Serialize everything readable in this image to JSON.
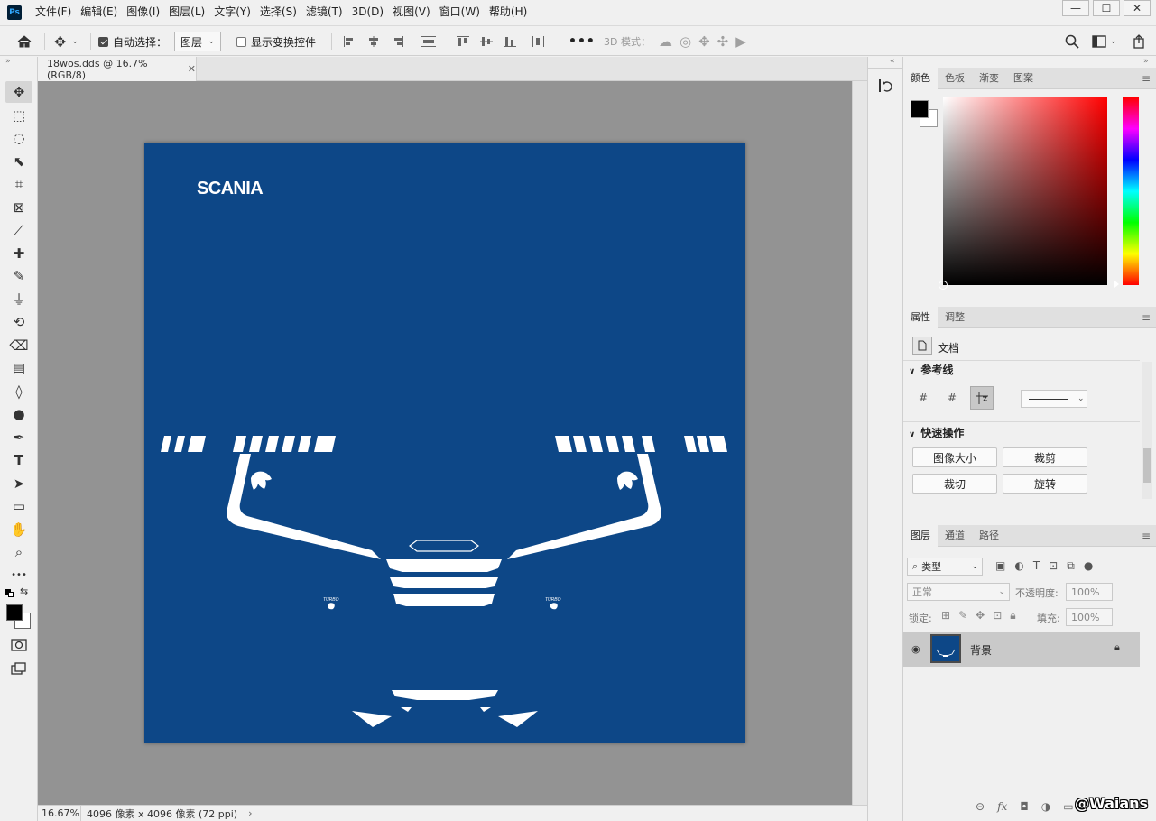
{
  "app": {
    "logo": "Ps"
  },
  "menu": [
    "文件(F)",
    "编辑(E)",
    "图像(I)",
    "图层(L)",
    "文字(Y)",
    "选择(S)",
    "滤镜(T)",
    "3D(D)",
    "视图(V)",
    "窗口(W)",
    "帮助(H)"
  ],
  "window_controls": {
    "minimize": "—",
    "maximize": "☐",
    "close": "✕"
  },
  "options": {
    "auto_select_label": "自动选择：",
    "auto_select_checked": true,
    "auto_select_target": "图层",
    "transform_label": "显示变换控件",
    "transform_checked": false,
    "mode_3d_label": "3D 模式："
  },
  "tools": [
    {
      "name": "move-tool",
      "glyph": "✥",
      "active": true
    },
    {
      "name": "marquee-tool",
      "glyph": "⬚"
    },
    {
      "name": "lasso-tool",
      "glyph": "◌"
    },
    {
      "name": "object-select-tool",
      "glyph": "⬉"
    },
    {
      "name": "crop-tool",
      "glyph": "⌗"
    },
    {
      "name": "frame-tool",
      "glyph": "⊠"
    },
    {
      "name": "eyedropper-tool",
      "glyph": "⟋"
    },
    {
      "name": "healing-brush-tool",
      "glyph": "✚"
    },
    {
      "name": "brush-tool",
      "glyph": "✎"
    },
    {
      "name": "clone-stamp-tool",
      "glyph": "⏚"
    },
    {
      "name": "history-brush-tool",
      "glyph": "⟲"
    },
    {
      "name": "eraser-tool",
      "glyph": "⌫"
    },
    {
      "name": "gradient-tool",
      "glyph": "▤"
    },
    {
      "name": "blur-tool",
      "glyph": "◊"
    },
    {
      "name": "dodge-tool",
      "glyph": "●"
    },
    {
      "name": "pen-tool",
      "glyph": "✒"
    },
    {
      "name": "type-tool",
      "glyph": "T"
    },
    {
      "name": "path-select-tool",
      "glyph": "➤"
    },
    {
      "name": "rectangle-tool",
      "glyph": "▭"
    },
    {
      "name": "hand-tool",
      "glyph": "✋"
    },
    {
      "name": "zoom-tool",
      "glyph": "⌕"
    },
    {
      "name": "more-tools",
      "glyph": "•••"
    }
  ],
  "document": {
    "tab_title": "18wos.dds @ 16.7%(RGB/8)",
    "brand_text": "SCANIA",
    "turbo_text": "TURBO",
    "canvas_color": "#0d4787"
  },
  "status": {
    "zoom": "16.67%",
    "info": "4096 像素 x 4096 像素 (72 ppi)"
  },
  "color_panel": {
    "tabs": [
      "颜色",
      "色板",
      "渐变",
      "图案"
    ],
    "active": 0
  },
  "properties_panel": {
    "tabs": [
      "属性",
      "调整"
    ],
    "active": 0,
    "doc_label": "文档",
    "guides_title": "参考线",
    "quick_title": "快速操作",
    "buttons": [
      "图像大小",
      "裁剪",
      "裁切",
      "旋转"
    ]
  },
  "layers_panel": {
    "tabs": [
      "图层",
      "通道",
      "路径"
    ],
    "active": 0,
    "filter_label": "类型",
    "blend_mode": "正常",
    "opacity_label": "不透明度:",
    "opacity_value": "100%",
    "lock_label": "锁定:",
    "fill_label": "填充:",
    "fill_value": "100%",
    "layers": [
      {
        "name": "背景",
        "locked": true,
        "visible": true
      }
    ]
  },
  "watermark": "@Waians",
  "colors": {
    "foreground": "#000000",
    "background": "#ffffff"
  }
}
